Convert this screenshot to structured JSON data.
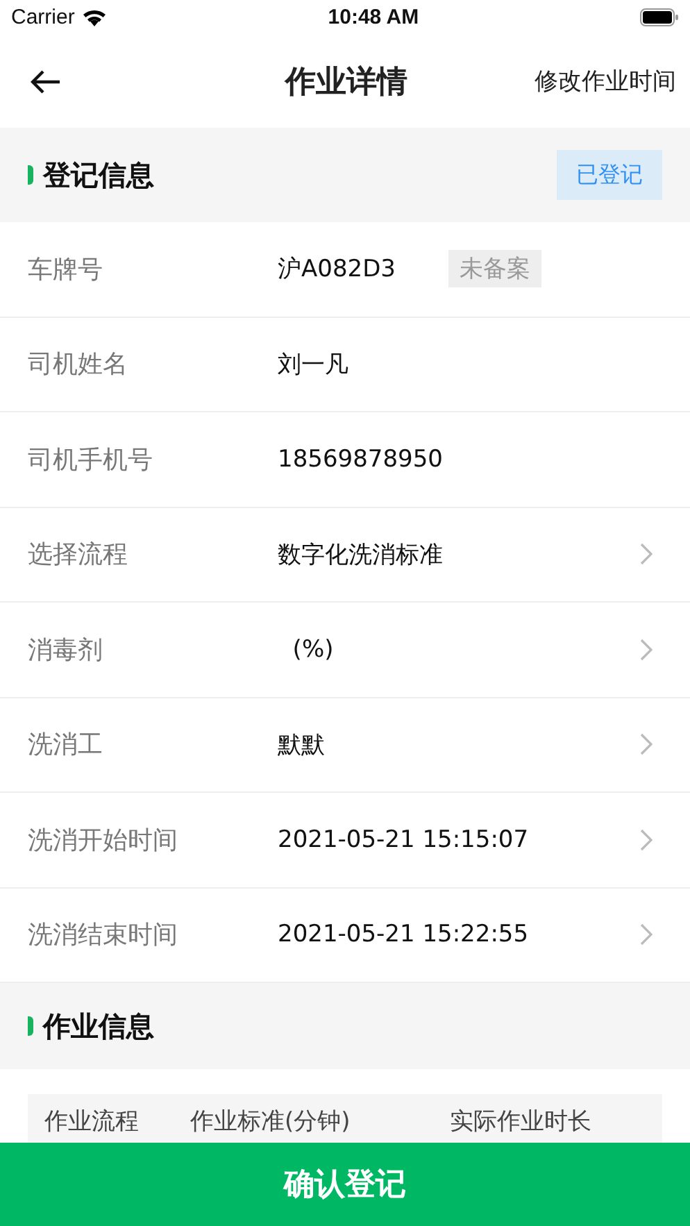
{
  "status_bar": {
    "carrier": "Carrier",
    "time": "10:48 AM"
  },
  "nav": {
    "title": "作业详情",
    "action": "修改作业时间"
  },
  "registration": {
    "title": "登记信息",
    "status": "已登记",
    "rows": [
      {
        "label": "车牌号",
        "value": "沪A082D3",
        "tag": "未备案",
        "chevron": false
      },
      {
        "label": "司机姓名",
        "value": "刘一凡",
        "chevron": false
      },
      {
        "label": "司机手机号",
        "value": "18569878950",
        "chevron": false
      },
      {
        "label": "选择流程",
        "value": "数字化洗消标准",
        "chevron": true
      },
      {
        "label": "消毒剂",
        "value": "  (%)",
        "chevron": true
      },
      {
        "label": "洗消工",
        "value": "默默",
        "chevron": true
      },
      {
        "label": "洗消开始时间",
        "value": "2021-05-21 15:15:07",
        "chevron": true
      },
      {
        "label": "洗消结束时间",
        "value": "2021-05-21 15:22:55",
        "chevron": true
      }
    ]
  },
  "work": {
    "title": "作业信息",
    "table": {
      "columns": [
        "作业流程",
        "作业标准(分钟)",
        "实际作业时长"
      ]
    }
  },
  "confirm_button": "确认登记"
}
